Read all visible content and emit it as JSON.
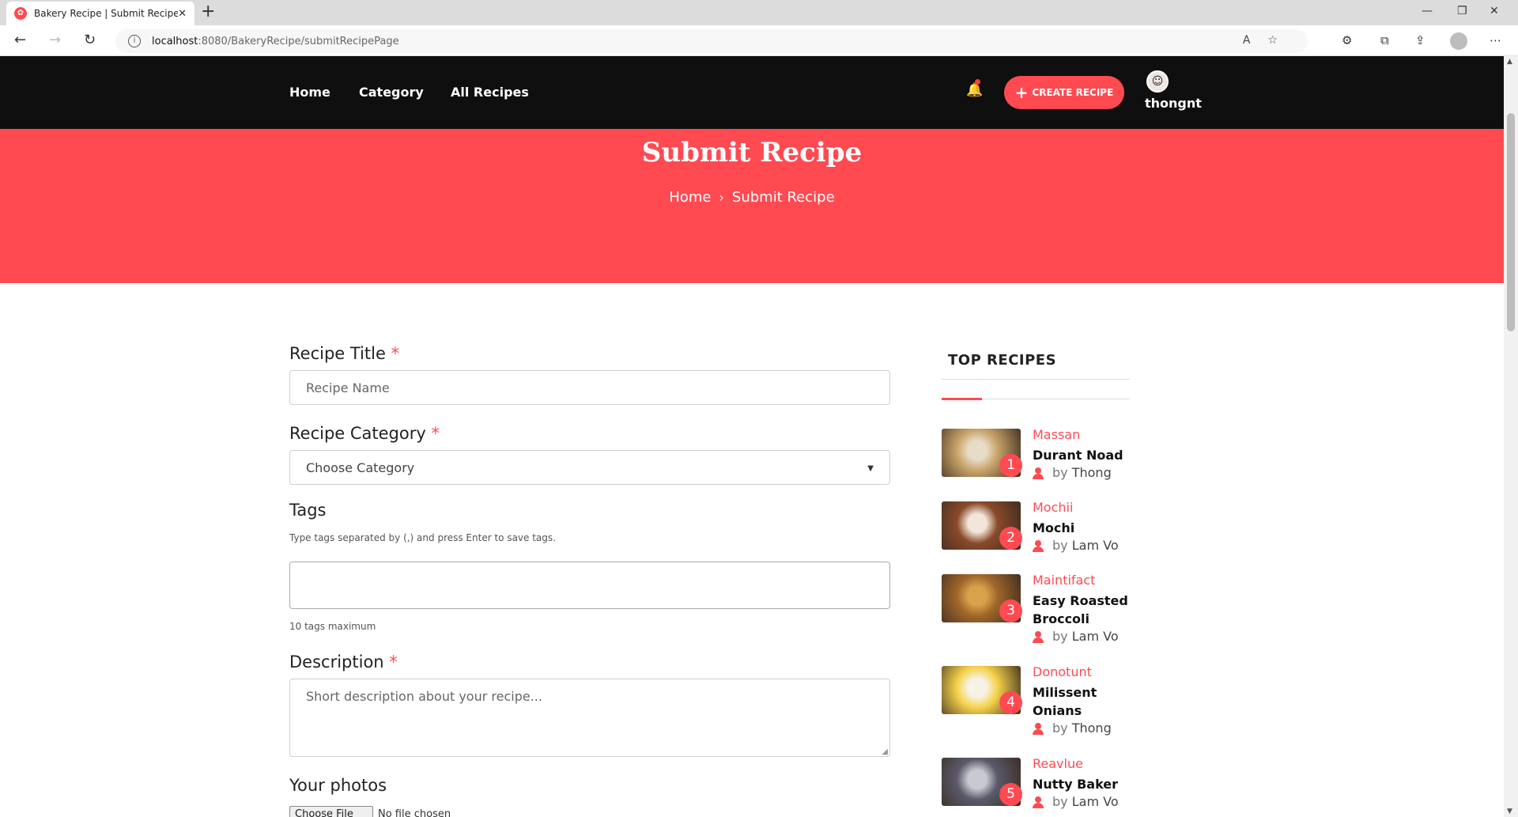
{
  "browser": {
    "tab_title": "Bakery Recipe | Submit Recipes",
    "url_host": "localhost",
    "url_path": ":8080/BakeryRecipe/submitRecipePage"
  },
  "nav": {
    "home": "Home",
    "category": "Category",
    "all_recipes": "All Recipes",
    "create_recipe": "CREATE RECIPE",
    "username": "thongnt"
  },
  "hero": {
    "title": "Submit Recipe",
    "crumb_home": "Home",
    "crumb_current": "Submit Recipe"
  },
  "form": {
    "title_label": "Recipe Title",
    "title_placeholder": "Recipe Name",
    "category_label": "Recipe Category",
    "category_value": "Choose Category",
    "tags_label": "Tags",
    "tags_hint": "Type tags separated by (,) and press Enter to save tags.",
    "tags_max": "10 tags maximum",
    "description_label": "Description",
    "description_placeholder": "Short description about your recipe...",
    "photos_label": "Your photos",
    "file_button": "Choose File",
    "file_status": "No file chosen",
    "required_mark": "*"
  },
  "sidebar": {
    "title": "TOP RECIPES",
    "recipes": [
      {
        "rank": "1",
        "category": "Massan",
        "name": "Durant Noad",
        "author": "Thong",
        "colors": [
          "#c9a46a",
          "#e8dcc8"
        ]
      },
      {
        "rank": "2",
        "category": "Mochii",
        "name": "Mochi",
        "author": "Lam Vo",
        "colors": [
          "#8a4a2a",
          "#f3e6d8"
        ]
      },
      {
        "rank": "3",
        "category": "Maintifact",
        "name": "Easy Roasted Broccoli",
        "author": "Lam Vo",
        "colors": [
          "#a0662a",
          "#d7a24a"
        ]
      },
      {
        "rank": "4",
        "category": "Donotunt",
        "name": "Milissent Onians",
        "author": "Thong",
        "colors": [
          "#f6d24a",
          "#f7f2e6"
        ]
      },
      {
        "rank": "5",
        "category": "Reavlue",
        "name": "Nutty Baker",
        "author": "Lam Vo",
        "colors": [
          "#5a5a6a",
          "#c9c9d2"
        ]
      }
    ],
    "by_prefix": "by"
  }
}
